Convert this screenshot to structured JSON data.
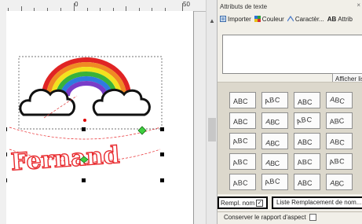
{
  "ruler": {
    "labels": [
      "0",
      "50"
    ]
  },
  "panel": {
    "title": "Attributs de texte",
    "close_glyph": "×",
    "toolbar": [
      {
        "label": "Importer",
        "icon": "import-icon"
      },
      {
        "label": "Couleur",
        "icon": "color-icon"
      },
      {
        "label": "Caractèr...",
        "icon": "character-icon"
      },
      {
        "label": "Attrib",
        "icon": "attributes-icon",
        "prefix": "AB"
      }
    ],
    "text_value": "",
    "afficher_label": "Afficher list",
    "shape_label": "ABC",
    "shapes_count": 20,
    "rempl_label": "Rempl. nom",
    "rempl_checked": "✓",
    "liste_label": "Liste Remplacement de nom...",
    "aspect_label": "Conserver le rapport d'aspect"
  },
  "canvas": {
    "text": "Fernand",
    "text_color": "#e8282c",
    "rainbow_colors": [
      "#e02424",
      "#f08a24",
      "#f2e21e",
      "#38b23a",
      "#2f7ae0",
      "#7a3cc8"
    ]
  }
}
